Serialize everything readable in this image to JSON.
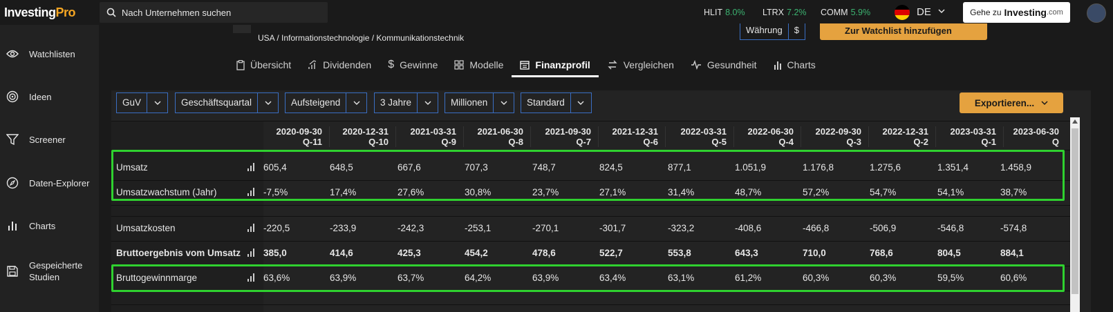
{
  "logo": {
    "text": "Investing",
    "pro": "Pro"
  },
  "search": {
    "placeholder": "Nach Unternehmen suchen"
  },
  "tickers": [
    {
      "symbol": "HLIT",
      "change": "8.0%"
    },
    {
      "symbol": "LTRX",
      "change": "7.2%"
    },
    {
      "symbol": "COMM",
      "change": "5.9%"
    }
  ],
  "language": "DE",
  "goto": {
    "prefix": "Gehe zu",
    "brand": "Investing",
    "suffix": ".com"
  },
  "sidebar": {
    "items": [
      {
        "label": "Watchlisten",
        "icon": "eye-icon"
      },
      {
        "label": "Ideen",
        "icon": "target-icon"
      },
      {
        "label": "Screener",
        "icon": "filter-icon"
      },
      {
        "label": "Daten-Explorer",
        "icon": "compass-icon"
      },
      {
        "label": "Charts",
        "icon": "bar-chart-icon"
      },
      {
        "label": "Gespeicherte Studien",
        "icon": "save-icon"
      }
    ]
  },
  "breadcrumb": "USA / Informationstechnologie / Kommunikationstechnik",
  "header": {
    "currency_label": "Währung",
    "currency_value": "$",
    "watchlist_button": "Zur Watchlist hinzufügen"
  },
  "tabs": [
    {
      "label": "Übersicht",
      "icon": "clipboard-icon"
    },
    {
      "label": "Dividenden",
      "icon": "dividend-icon"
    },
    {
      "label": "Gewinne",
      "icon": "dollar-icon"
    },
    {
      "label": "Modelle",
      "icon": "grid-icon"
    },
    {
      "label": "Finanzprofil",
      "icon": "calendar-icon",
      "active": true
    },
    {
      "label": "Vergleichen",
      "icon": "swap-icon"
    },
    {
      "label": "Gesundheit",
      "icon": "pulse-icon"
    },
    {
      "label": "Charts",
      "icon": "bar-chart-icon"
    }
  ],
  "controls": {
    "statement": "GuV",
    "period": "Geschäftsquartal",
    "order": "Aufsteigend",
    "range": "3 Jahre",
    "units": "Millionen",
    "view": "Standard",
    "export": "Exportieren..."
  },
  "table": {
    "columns": [
      {
        "date": "2020-09-30",
        "q": "Q-11"
      },
      {
        "date": "2020-12-31",
        "q": "Q-10"
      },
      {
        "date": "2021-03-31",
        "q": "Q-9"
      },
      {
        "date": "2021-06-30",
        "q": "Q-8"
      },
      {
        "date": "2021-09-30",
        "q": "Q-7"
      },
      {
        "date": "2021-12-31",
        "q": "Q-6"
      },
      {
        "date": "2022-03-31",
        "q": "Q-5"
      },
      {
        "date": "2022-06-30",
        "q": "Q-4"
      },
      {
        "date": "2022-09-30",
        "q": "Q-3"
      },
      {
        "date": "2022-12-31",
        "q": "Q-2"
      },
      {
        "date": "2023-03-31",
        "q": "Q-1"
      },
      {
        "date": "2023-06-30",
        "q": "Q"
      }
    ],
    "rows": [
      {
        "label": "Umsatz",
        "values": [
          "605,4",
          "648,5",
          "667,6",
          "707,3",
          "748,7",
          "824,5",
          "877,1",
          "1.051,9",
          "1.176,8",
          "1.275,6",
          "1.351,4",
          "1.458,9"
        ]
      },
      {
        "label": "Umsatzwachstum (Jahr)",
        "values": [
          "-7,5%",
          "17,4%",
          "27,6%",
          "30,8%",
          "23,7%",
          "27,1%",
          "31,4%",
          "48,7%",
          "57,2%",
          "54,7%",
          "54,1%",
          "38,7%"
        ]
      },
      {
        "label": "Umsatzkosten",
        "values": [
          "-220,5",
          "-233,9",
          "-242,3",
          "-253,1",
          "-270,1",
          "-301,7",
          "-323,2",
          "-408,6",
          "-466,8",
          "-506,9",
          "-546,8",
          "-574,8"
        ]
      },
      {
        "label": "Bruttoergebnis vom Umsatz",
        "bold": true,
        "values": [
          "385,0",
          "414,6",
          "425,3",
          "454,2",
          "478,6",
          "522,7",
          "553,8",
          "643,3",
          "710,0",
          "768,6",
          "804,5",
          "884,1"
        ]
      },
      {
        "label": "Bruttogewinnmarge",
        "values": [
          "63,6%",
          "63,9%",
          "63,7%",
          "64,2%",
          "63,9%",
          "63,4%",
          "63,1%",
          "61,2%",
          "60,3%",
          "60,3%",
          "59,5%",
          "60,6%"
        ]
      }
    ]
  },
  "highlight_color": "#2fd12f"
}
